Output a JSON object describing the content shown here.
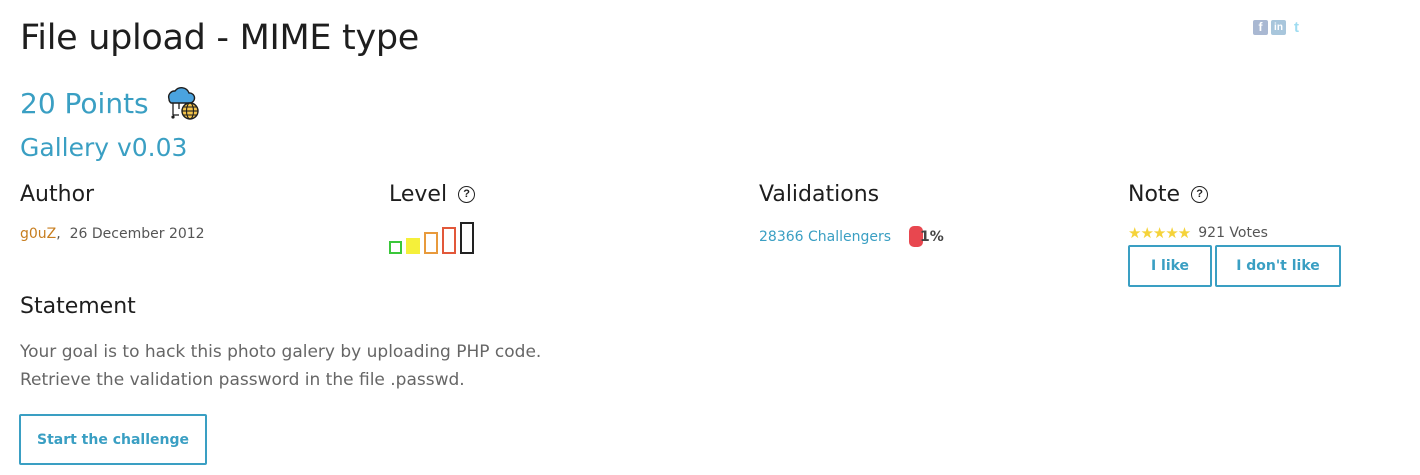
{
  "title": "File upload - MIME type",
  "social": [
    {
      "name": "facebook-icon",
      "glyph": "f"
    },
    {
      "name": "linkedin-icon",
      "glyph": "in"
    },
    {
      "name": "twitter-icon",
      "glyph": "t"
    }
  ],
  "points": "20 Points",
  "category_icon": "cloud-globe-network-icon",
  "subtitle": "Gallery v0.03",
  "author": {
    "heading": "Author",
    "name": "g0uZ",
    "separator": ",",
    "date": "26 December 2012"
  },
  "level": {
    "heading": "Level",
    "help": "?",
    "bars": [
      {
        "color": "#3ac73a",
        "filled": false
      },
      {
        "color": "#f5f03a",
        "filled": true
      },
      {
        "color": "#e89a3c",
        "filled": false
      },
      {
        "color": "#e2583a",
        "filled": false
      },
      {
        "color": "#222222",
        "filled": false
      }
    ],
    "current_level": 2
  },
  "validations": {
    "heading": "Validations",
    "challengers": "28366 Challengers",
    "percent": "1%",
    "pill_color": "#e8474f"
  },
  "note": {
    "heading": "Note",
    "help": "?",
    "stars": "★★★★★",
    "votes": "921 Votes",
    "like_label": "I like",
    "dislike_label": "I don't like"
  },
  "statement": {
    "heading": "Statement",
    "lines": [
      "Your goal is to hack this photo galery by uploading PHP code.",
      "Retrieve the validation password in the file .passwd."
    ]
  },
  "start_button": "Start the challenge",
  "colors": {
    "accent": "#3a9fc3",
    "author_link": "#c77d1e"
  }
}
